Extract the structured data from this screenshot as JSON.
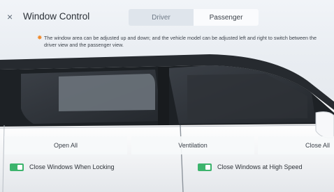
{
  "header": {
    "close_icon": "×",
    "title": "Window Control",
    "tabs": [
      {
        "label": "Driver",
        "active": true
      },
      {
        "label": "Passenger",
        "active": false
      }
    ]
  },
  "hint": {
    "icon": "✸",
    "text": "The window area can be adjusted up and down; and the vehicle model can be adjusted left and right to switch between the driver view and the passenger view."
  },
  "actions": {
    "open_all": "Open All",
    "ventilation": "Ventilation",
    "close_all": "Close All"
  },
  "toggles": {
    "close_when_locking": {
      "label": "Close Windows When Locking",
      "on": true
    },
    "close_at_high_speed": {
      "label": "Close Windows at High Speed",
      "on": true
    }
  },
  "colors": {
    "accent_green": "#3db46d",
    "hint_orange": "#f08a2c"
  }
}
